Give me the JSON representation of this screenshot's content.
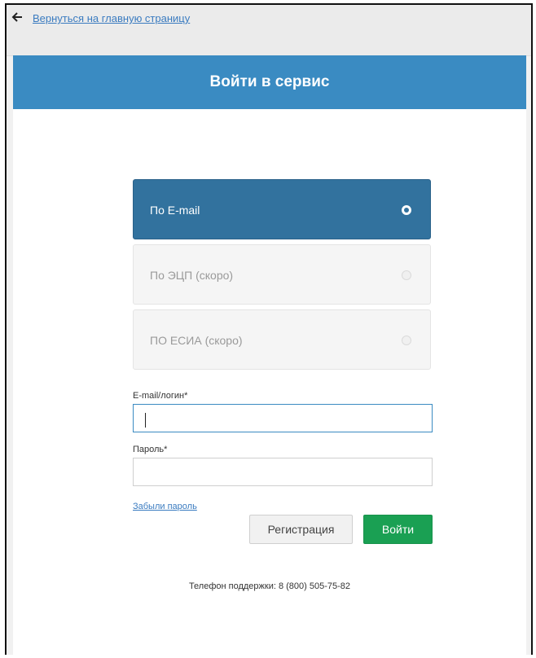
{
  "nav": {
    "back_icon": "arrow-left-icon",
    "back_link": "Вернуться на главную страницу"
  },
  "header": {
    "title": "Войти в сервис"
  },
  "auth_methods": [
    {
      "label": "По E-mail",
      "selected": true,
      "enabled": true
    },
    {
      "label": "По ЭЦП (скоро)",
      "selected": false,
      "enabled": false
    },
    {
      "label": "ПО ЕСИА (скоро)",
      "selected": false,
      "enabled": false
    }
  ],
  "form": {
    "login_label": "E-mail/логин*",
    "login_value": "",
    "password_label": "Пароль*",
    "password_value": "",
    "forgot_link": "Забыли пароль",
    "register_button": "Регистрация",
    "login_button": "Войти"
  },
  "footer": {
    "support_text": "Телефон поддержки: 8 (800) 505-75-82"
  },
  "colors": {
    "header_bg": "#3a8bc2",
    "active_method_bg": "#32729e",
    "login_button_bg": "#1aa053",
    "link": "#3a7bc0"
  }
}
